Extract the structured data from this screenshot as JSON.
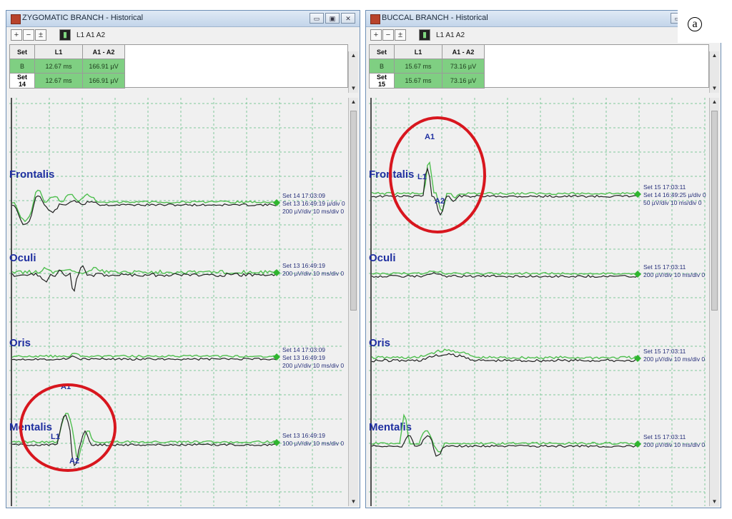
{
  "figure_tag": "a",
  "toolbar": {
    "zoom_in": "+",
    "zoom_out": "−",
    "zoom_fit": "±",
    "spectrum": "▮",
    "markers": "L1  A1  A2"
  },
  "window_buttons": {
    "minimize": "▭",
    "restore": "▣",
    "close": "✕"
  },
  "table_headers": {
    "set": "Set",
    "l1": "L1",
    "a1a2": "A1 - A2"
  },
  "colors": {
    "trace_black": "#202020",
    "trace_green": "#4fbf4f",
    "grid": "#7fc99a",
    "label": "#1f2fa0",
    "circle": "#d8161e"
  },
  "icons": [
    "zoom-in-icon",
    "zoom-out-icon",
    "zoom-fit-icon",
    "spectrum-icon",
    "app-icon",
    "minimize-icon",
    "restore-icon",
    "close-icon",
    "scroll-up-icon",
    "scroll-down-icon",
    "marker-diamond-icon"
  ],
  "windows": [
    {
      "title": "ZYGOMATIC BRANCH - Historical",
      "rows": [
        {
          "set": "B",
          "l1": "12.67 ms",
          "a1a2": "166.91 µV"
        },
        {
          "set": "Set 14",
          "l1": "12.67 ms",
          "a1a2": "166.91 µV"
        }
      ],
      "channels": [
        {
          "name": "Frontalis",
          "info": [
            "Set 14 17:03:09",
            "Set 13 16:49:19 µ/div 0",
            "200 µV/div 10 ms/div 0"
          ]
        },
        {
          "name": "Oculi",
          "info": [
            "Set 13 16:49:19",
            "200 µV/div 10 ms/div 0"
          ]
        },
        {
          "name": "Oris",
          "info": [
            "Set 14 17:03:09",
            "Set 13 16:49:19",
            "200 µV/div 10 ms/div 0"
          ]
        },
        {
          "name": "Mentalis",
          "info": [
            "Set 13 16:49:19",
            "100 µV/div 10 ms/div 0"
          ]
        }
      ],
      "markers": {
        "a1": "A1",
        "l1": "L1",
        "a2": "A2"
      }
    },
    {
      "title": "BUCCAL BRANCH - Historical",
      "rows": [
        {
          "set": "B",
          "l1": "15.67 ms",
          "a1a2": "73.16 µV"
        },
        {
          "set": "Set 15",
          "l1": "15.67 ms",
          "a1a2": "73.16 µV"
        }
      ],
      "channels": [
        {
          "name": "Frontalis",
          "info": [
            "Set 15 17:03:11",
            "Set 14 16:49:25 µ/div 0",
            "50 µV/div 10 ms/div 0"
          ]
        },
        {
          "name": "Oculi",
          "info": [
            "Set 15 17:03:11",
            "200 µV/div 10 ms/div 0"
          ]
        },
        {
          "name": "Oris",
          "info": [
            "Set 15 17:03:11",
            "200 µV/div 10 ms/div 0"
          ]
        },
        {
          "name": "Mentalis",
          "info": [
            "Set 15 17:03:11",
            "200 µV/div 10 ms/div 0"
          ]
        }
      ],
      "markers": {
        "a1": "A1",
        "l1": "L1",
        "a2": "A2"
      }
    }
  ]
}
